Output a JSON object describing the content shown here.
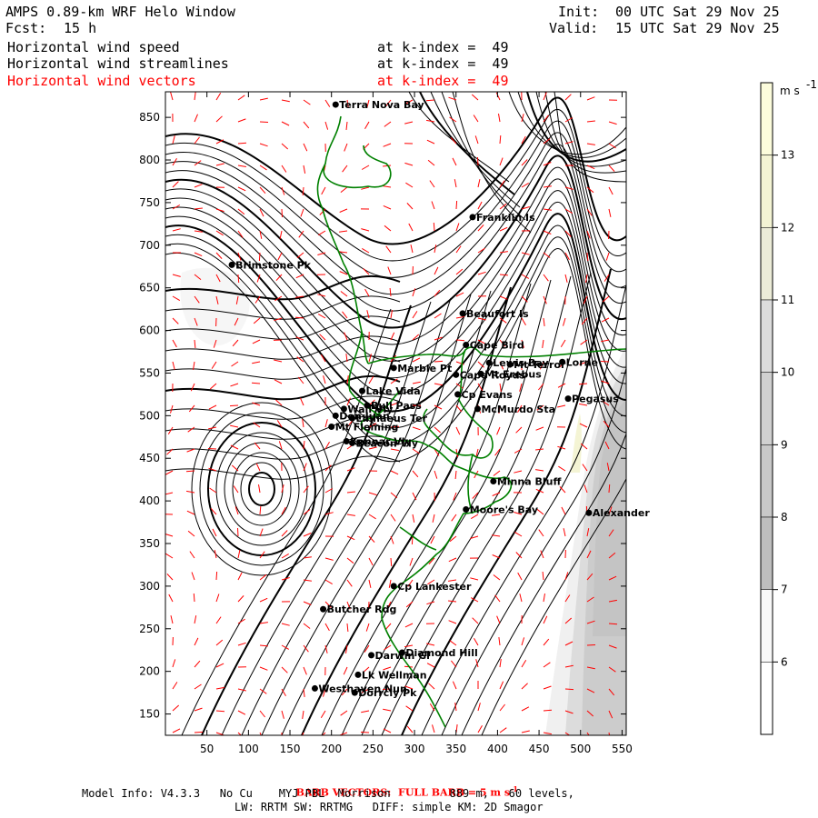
{
  "header": {
    "title": "AMPS 0.89-km WRF Helo Window",
    "forecast_label": "Fcst:",
    "forecast_value": "15 h",
    "init_label": "Init:",
    "init_value": "00 UTC Sat 29 Nov 25",
    "valid_label": "Valid:",
    "valid_value": "15 UTC Sat 29 Nov 25",
    "fields": [
      {
        "name": "Horizontal wind speed",
        "level": "at k-index =  49",
        "color": "#000000"
      },
      {
        "name": "Horizontal wind streamlines",
        "level": "at k-index =  49",
        "color": "#000000"
      },
      {
        "name": "Horizontal wind vectors",
        "level": "at k-index =  49",
        "color": "#ff0000"
      }
    ]
  },
  "map": {
    "x_ticks": [
      "50",
      "100",
      "150",
      "200",
      "250",
      "300",
      "350",
      "400",
      "450",
      "500",
      "550"
    ],
    "y_ticks": [
      "850",
      "800",
      "750",
      "700",
      "650",
      "600",
      "550",
      "500",
      "450",
      "400",
      "350",
      "300",
      "250",
      "200",
      "150"
    ],
    "x_range": [
      0,
      555
    ],
    "y_range": [
      125,
      880
    ],
    "coastline_color": "#008000",
    "streamline_color": "#000000",
    "barb_color": "#ff0000",
    "stations": [
      {
        "name": "Terra Nova Bay",
        "x": 205,
        "y": 865
      },
      {
        "name": "Franklin Is",
        "x": 370,
        "y": 733
      },
      {
        "name": "Brimstone Pk",
        "x": 80,
        "y": 677
      },
      {
        "name": "Beaufort Is",
        "x": 358,
        "y": 620
      },
      {
        "name": "Cape Bird",
        "x": 362,
        "y": 583
      },
      {
        "name": "Marble Pt",
        "x": 275,
        "y": 556
      },
      {
        "name": "Cape Royds",
        "x": 350,
        "y": 548
      },
      {
        "name": "Mt Erebus",
        "x": 380,
        "y": 549
      },
      {
        "name": "Lewis Bay",
        "x": 390,
        "y": 562
      },
      {
        "name": "Mt Terror",
        "x": 415,
        "y": 560
      },
      {
        "name": "Lorne",
        "x": 478,
        "y": 563
      },
      {
        "name": "Cp Evans",
        "x": 352,
        "y": 525
      },
      {
        "name": "Lake Vida",
        "x": 237,
        "y": 529
      },
      {
        "name": "Wall Vly",
        "x": 215,
        "y": 508
      },
      {
        "name": "Bull Pass",
        "x": 243,
        "y": 512
      },
      {
        "name": "Don Juan",
        "x": 205,
        "y": 500
      },
      {
        "name": "Linnaeus Ter",
        "x": 225,
        "y": 497
      },
      {
        "name": "McMurdo Sta",
        "x": 376,
        "y": 508
      },
      {
        "name": "Pegasus",
        "x": 485,
        "y": 520
      },
      {
        "name": "Mt Fleming",
        "x": 200,
        "y": 487
      },
      {
        "name": "Kennar Vly",
        "x": 218,
        "y": 470
      },
      {
        "name": "Beacon Vly",
        "x": 225,
        "y": 468
      },
      {
        "name": "Minna Bluff",
        "x": 395,
        "y": 423
      },
      {
        "name": "Moore's Bay",
        "x": 362,
        "y": 390
      },
      {
        "name": "Alexander",
        "x": 510,
        "y": 386
      },
      {
        "name": "Cp Lankester",
        "x": 275,
        "y": 300
      },
      {
        "name": "Butcher Rdg",
        "x": 190,
        "y": 273
      },
      {
        "name": "Darwin Gl",
        "x": 248,
        "y": 219
      },
      {
        "name": "Diamond Hill",
        "x": 285,
        "y": 222
      },
      {
        "name": "Lk Wellman",
        "x": 232,
        "y": 196
      },
      {
        "name": "Westhaven Nun",
        "x": 180,
        "y": 180
      },
      {
        "name": "Dorrcly Pk",
        "x": 228,
        "y": 175
      }
    ]
  },
  "colorbar": {
    "units": "m s",
    "units_exp": "-1",
    "labels": [
      "13",
      "12",
      "11",
      "10",
      "9",
      "8",
      "7",
      "6"
    ],
    "colors": [
      "#fcfcdc",
      "#f4f4d4",
      "#ececd8",
      "#dcdcdc",
      "#d0d0d0",
      "#c8c8c8",
      "#bebebe",
      "#f8f8f8",
      "#ffffff"
    ]
  },
  "footer": {
    "barb_note": "BARB VECTORS:  FULL BARB = 5 m s",
    "barb_exp": "-1",
    "model_info_1": "Model Info: V4.3.3   No Cu    MYJ PBL  Morrison         889 m,   60 levels,",
    "model_info_2": "LW: RRTM SW: RRTMG   DIFF: simple KM: 2D Smagor"
  }
}
